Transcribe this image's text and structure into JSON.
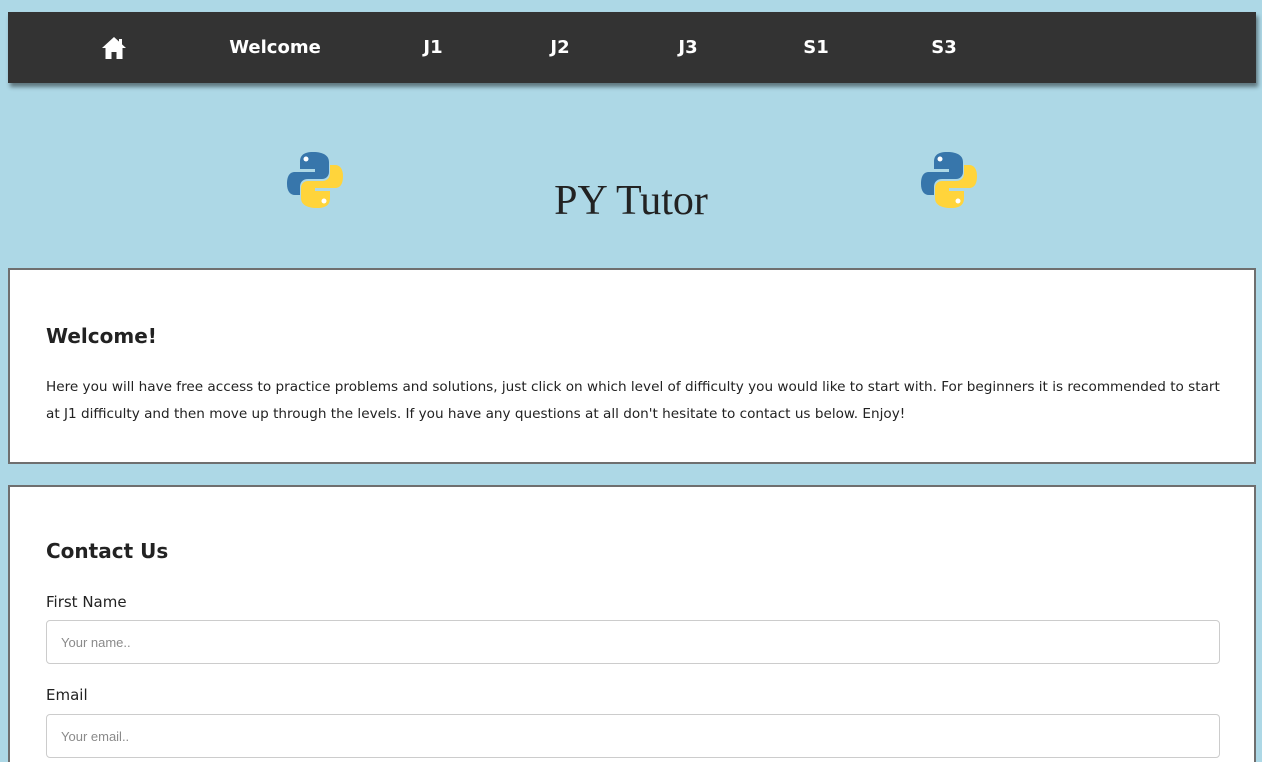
{
  "nav": {
    "home_icon": "home-icon",
    "items": [
      "Welcome",
      "J1",
      "J2",
      "J3",
      "S1",
      "S3"
    ]
  },
  "header": {
    "title": "PY Tutor",
    "logo_icon": "python-logo"
  },
  "welcome": {
    "heading": "Welcome!",
    "body": "Here you will have free access to practice problems and solutions, just click on which level of difficulty you would like to start with. For beginners it is recommended to start at J1 difficulty and then move up through the levels. If you have any questions at all don't hesitate to contact us below. Enjoy!"
  },
  "contact": {
    "heading": "Contact Us",
    "first_name_label": "First Name",
    "first_name_placeholder": "Your name..",
    "email_label": "Email",
    "email_placeholder": "Your email.."
  },
  "colors": {
    "page_background": "#add8e6",
    "navbar_background": "#333333",
    "python_blue": "#3776ab",
    "python_yellow": "#ffd43b"
  }
}
